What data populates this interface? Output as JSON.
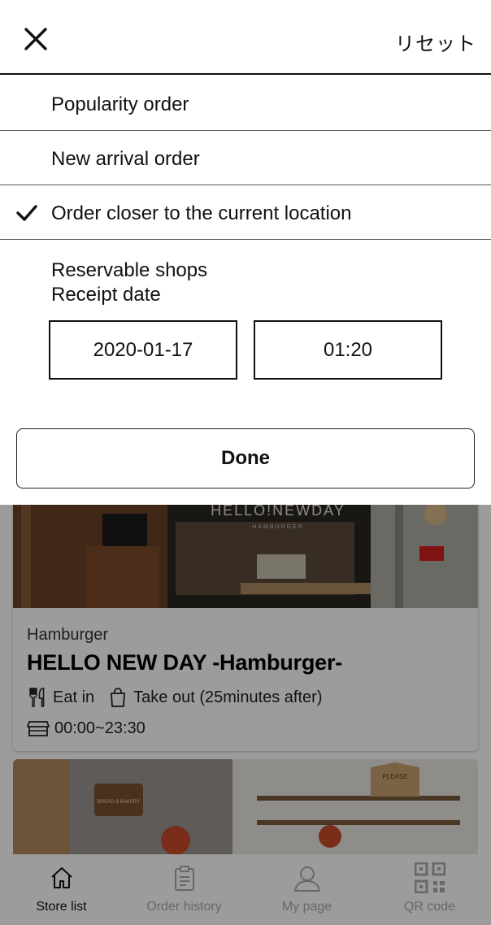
{
  "sheet": {
    "reset_label": "リセット",
    "sort_options": [
      {
        "label": "Popularity order",
        "selected": false
      },
      {
        "label": "New arrival order",
        "selected": false
      },
      {
        "label": "Order closer to the current location",
        "selected": true
      }
    ],
    "reservable_title_line1": "Reservable shops",
    "reservable_title_line2": "Receipt date",
    "date_value": "2020-01-17",
    "time_value": "01:20",
    "done_label": "Done"
  },
  "stores": [
    {
      "photo_sign": "HELLO!NEWDAY",
      "photo_subsign": "HAMBURGER",
      "category": "Hamburger",
      "name": "HELLO NEW DAY -Hamburger-",
      "eat_in": "Eat in",
      "take_out": "Take out (25minutes after)",
      "hours": "00:00~23:30"
    },
    {
      "photo_sign": "PLEASE",
      "photo_subsign": "BREAD & BAKERY"
    }
  ],
  "tabbar": {
    "tabs": [
      {
        "label": "Store list",
        "icon": "home-icon",
        "active": true
      },
      {
        "label": "Order history",
        "icon": "clipboard-icon",
        "active": false
      },
      {
        "label": "My page",
        "icon": "person-icon",
        "active": false
      },
      {
        "label": "QR code",
        "icon": "qr-code-icon",
        "active": false
      }
    ]
  },
  "colors": {
    "overlay": "#000000",
    "accent": "#111111",
    "inactive_tab": "#aaaaaa"
  }
}
